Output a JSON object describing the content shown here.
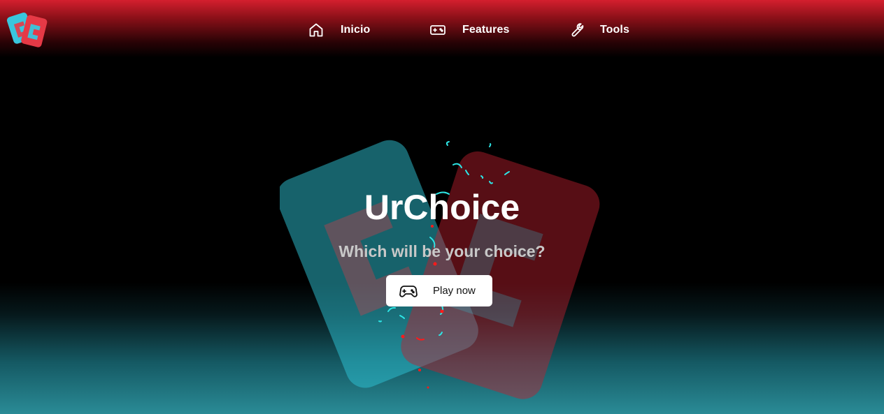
{
  "app": {
    "logo_icon": "urchoice-logo-icon"
  },
  "nav": {
    "items": [
      {
        "label": "Inicio",
        "icon": "home-icon"
      },
      {
        "label": "Features",
        "icon": "gamepad-icon"
      },
      {
        "label": "Tools",
        "icon": "wrench-icon"
      }
    ]
  },
  "hero": {
    "title": "UrChoice",
    "subtitle": "Which will be your choice?",
    "cta": {
      "label": "Play now",
      "icon": "gamepad-icon"
    }
  },
  "colors": {
    "brand_red": "#e63946",
    "brand_cyan": "#2ec4d6",
    "header_red": "#d41f2e",
    "footer_teal": "#2a8b96"
  }
}
